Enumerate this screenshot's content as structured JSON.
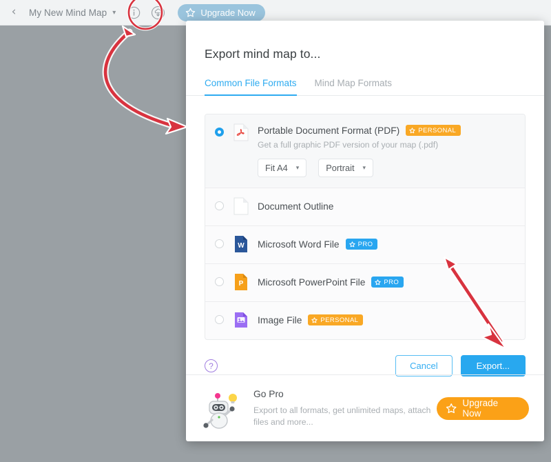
{
  "toolbar": {
    "back_icon": "chevron-left-icon",
    "map_title": "My New Mind Map",
    "title_caret": "chevron-down-icon",
    "info_icon": "info-icon",
    "download_icon": "download-cloud-icon",
    "upgrade_label": "Upgrade Now",
    "upgrade_star_icon": "star-icon"
  },
  "dialog": {
    "title": "Export mind map to...",
    "tabs": [
      {
        "label": "Common File Formats",
        "active": true
      },
      {
        "label": "Mind Map Formats",
        "active": false
      }
    ],
    "options": [
      {
        "label": "Portable Document Format (PDF)",
        "badge": "PERSONAL",
        "badge_type": "personal",
        "description": "Get a full graphic PDF version of your map (.pdf)",
        "selected": true,
        "icon": "pdf-file-icon",
        "selects": [
          {
            "name": "page-size-select",
            "value": "Fit A4"
          },
          {
            "name": "orientation-select",
            "value": "Portrait"
          }
        ]
      },
      {
        "label": "Document Outline",
        "badge": "",
        "badge_type": "",
        "description": "",
        "selected": false,
        "icon": "blank-document-icon",
        "selects": []
      },
      {
        "label": "Microsoft Word File",
        "badge": "PRO",
        "badge_type": "pro",
        "description": "",
        "selected": false,
        "icon": "word-file-icon",
        "selects": []
      },
      {
        "label": "Microsoft PowerPoint File",
        "badge": "PRO",
        "badge_type": "pro",
        "description": "",
        "selected": false,
        "icon": "powerpoint-file-icon",
        "selects": []
      },
      {
        "label": "Image File",
        "badge": "PERSONAL",
        "badge_type": "personal",
        "description": "",
        "selected": false,
        "icon": "image-file-icon",
        "selects": []
      }
    ],
    "help_icon_label": "?",
    "cancel_label": "Cancel",
    "export_label": "Export...",
    "gopro": {
      "title": "Go Pro",
      "description": "Export to all formats, get unlimited maps, attach files and more...",
      "button_label": "Upgrade Now",
      "mascot": "robot-mascot-icon"
    }
  },
  "annotations": {
    "highlight_circle": "download-button-highlight",
    "arrow_curved": "curved-arrow-to-dialog",
    "arrow_straight": "arrow-to-export-button",
    "color": "#d8333f"
  },
  "colors": {
    "accent_blue": "#28a8ef",
    "badge_orange": "#f9a825",
    "badge_blue": "#29a6f0",
    "upgrade_orange": "#fba117",
    "annotation_red": "#d8333f"
  }
}
